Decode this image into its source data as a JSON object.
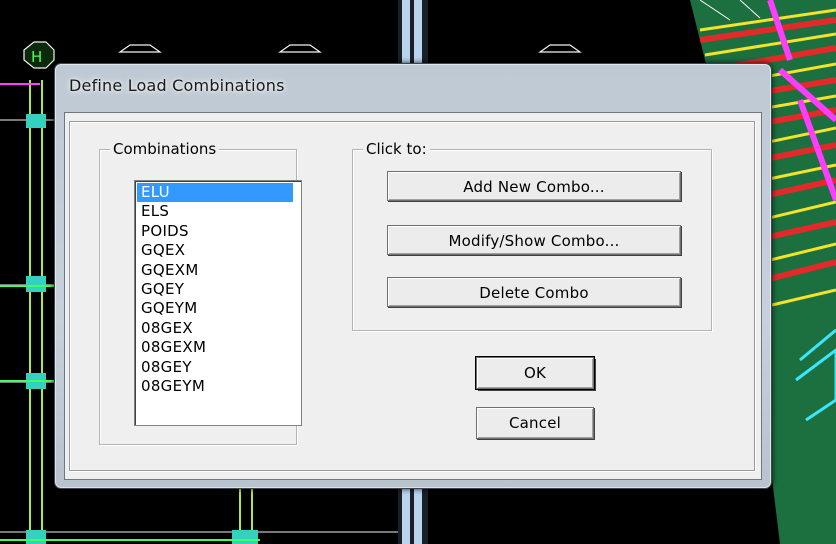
{
  "window": {
    "title": "Define Load Combinations"
  },
  "combinations": {
    "label": "Combinations",
    "items": [
      "ELU",
      "ELS",
      "POIDS",
      "GQEX",
      "GQEXM",
      "GQEY",
      "GQEYM",
      "08GEX",
      "08GEXM",
      "08GEY",
      "08GEYM"
    ],
    "selected": "ELU"
  },
  "click_to": {
    "label": "Click to:",
    "add_label": "Add New Combo...",
    "modify_label": "Modify/Show Combo...",
    "delete_label": "Delete Combo"
  },
  "footer": {
    "ok_label": "OK",
    "cancel_label": "Cancel"
  },
  "background": {
    "grid_label": "H"
  },
  "colors": {
    "selection": "#3399ff",
    "dialog_face": "#efefef",
    "background": "#000000"
  }
}
